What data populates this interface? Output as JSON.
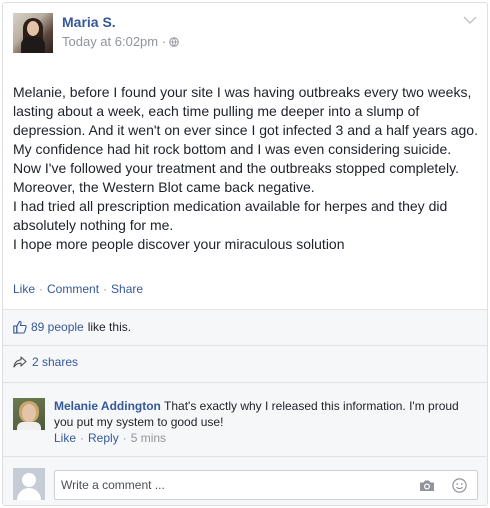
{
  "post": {
    "author": "Maria S.",
    "timestamp": "Today at 6:02pm ·",
    "paragraphs": [
      "Melanie, before I found your site I was having outbreaks every two weeks, lasting about a week, each time pulling me deeper into a slump of depression. And it wen't on ever since I got infected 3 and a half years ago.",
      "My confidence had hit rock bottom and I was even considering suicide. Now I've followed your treatment and the outbreaks stopped completely. Moreover, the Western Blot came back negative.",
      "I had tried all prescription medication available for herpes and they did absolutely nothing for me.",
      "I hope more people discover your miraculous solution"
    ],
    "actions": {
      "like": "Like",
      "comment": "Comment",
      "share": "Share",
      "separator": "·"
    }
  },
  "stats": {
    "likes_link": "89 people",
    "likes_suffix": "like this.",
    "shares": "2 shares"
  },
  "comment": {
    "name": "Melanie Addington",
    "text": "That's exactly why I released this information. I'm proud you put my system to good use!",
    "like": "Like",
    "reply": "Reply",
    "time": "5 mins",
    "separator": "·"
  },
  "composer": {
    "placeholder": "Write a comment ..."
  },
  "icons": {
    "privacy": "globe-icon",
    "menu": "chevron-down-icon",
    "likes": "thumbs-up-icon",
    "shares": "share-arrow-icon",
    "photo": "camera-icon",
    "emoji": "emoji-icon"
  },
  "colors": {
    "link": "#365899",
    "meta": "#90949c",
    "text": "#1d2129",
    "footer_bg": "#f6f7f9"
  }
}
